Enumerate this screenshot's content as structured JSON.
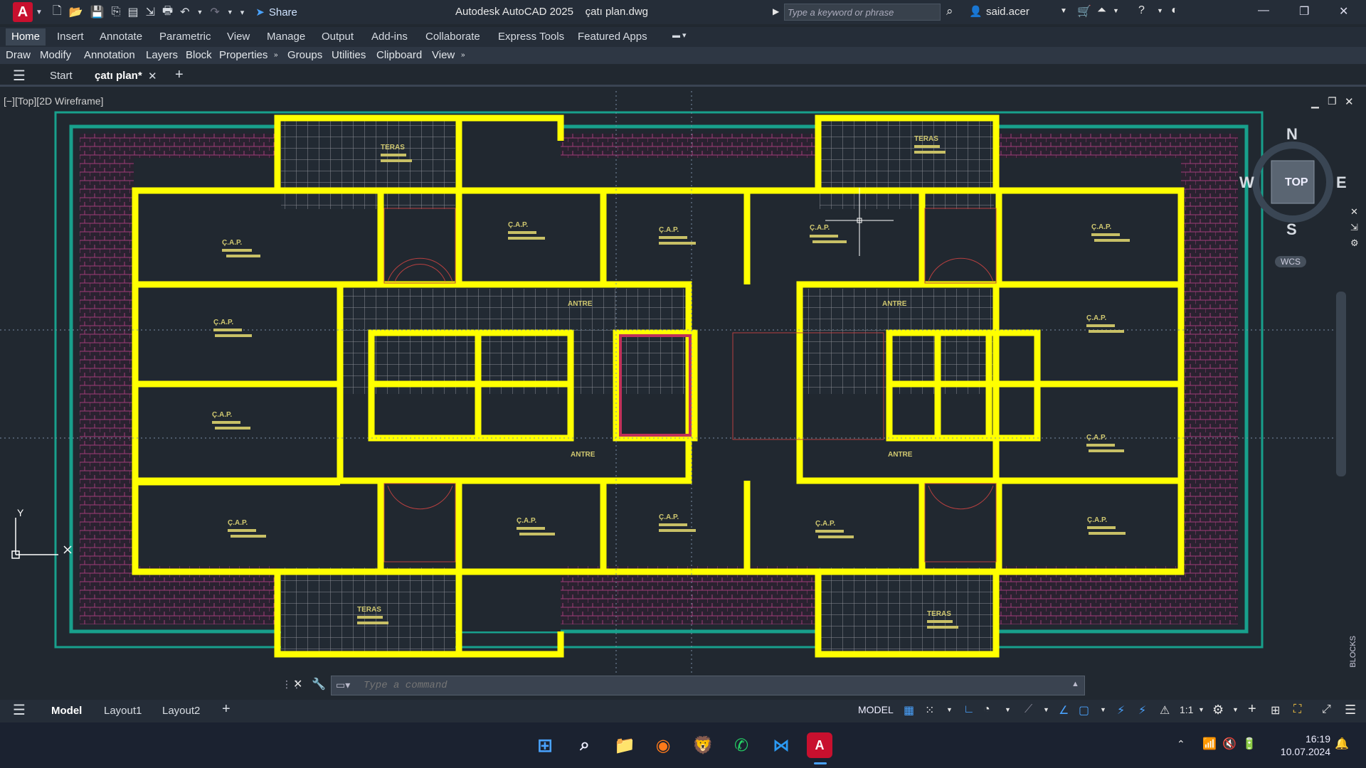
{
  "titlebar": {
    "app_icon": "A",
    "share_label": "Share",
    "window_title": "Autodesk AutoCAD 2025    çatı plan.dwg",
    "search_placeholder": "Type a keyword or phrase",
    "user_name": "said.acer"
  },
  "ribbon": {
    "tabs": [
      "Home",
      "Insert",
      "Annotate",
      "Parametric",
      "View",
      "Manage",
      "Output",
      "Add-ins",
      "Collaborate",
      "Express Tools",
      "Featured Apps"
    ],
    "active_tab": "Home",
    "panels": [
      "Draw",
      "Modify",
      "Annotation",
      "Layers",
      "Block",
      "Properties",
      "Groups",
      "Utilities",
      "Clipboard",
      "View"
    ]
  },
  "doc_tabs": {
    "start_label": "Start",
    "active_label": "çatı plan*"
  },
  "viewport": {
    "label": "[−][Top][2D Wireframe]",
    "viewcube": {
      "n": "N",
      "s": "S",
      "e": "E",
      "w": "W",
      "face": "TOP",
      "wcs": "WCS"
    },
    "ucs": {
      "y": "Y"
    },
    "blocks_label": "BLOCKS"
  },
  "drawing_labels": {
    "teras": "TERAS",
    "cap": "Ç.A.P.",
    "antre": "ANTRE"
  },
  "command": {
    "placeholder": "Type a command"
  },
  "statusbar": {
    "layouts": [
      "Model",
      "Layout1",
      "Layout2"
    ],
    "mode": "MODEL",
    "scale": "1:1"
  },
  "taskbar": {
    "time": "16:19",
    "date": "10.07.2024"
  },
  "colors": {
    "wall": "#ffff00",
    "tile": "#8c8f96",
    "roof": "#a03c78",
    "teal": "#18a08c",
    "background": "#212830"
  }
}
